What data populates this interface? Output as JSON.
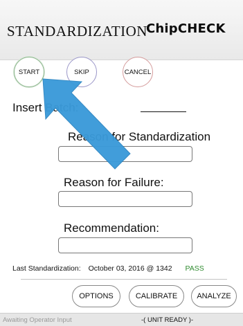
{
  "header": {
    "title": "STANDARDIZATION",
    "brand": "ChipCHECK"
  },
  "controls": {
    "start": "START",
    "skip": "SKIP",
    "cancel": "CANCEL"
  },
  "form": {
    "batch_label": "Insert Batch:",
    "reason_label": "Reason for Standardization",
    "failure_label": "Reason for Failure:",
    "recommendation_label": "Recommendation:",
    "reason_value": "",
    "failure_value": "",
    "recommendation_value": ""
  },
  "last_standardization": {
    "label": "Last Standardization:",
    "date": "October 03, 2016 @ 1342",
    "result": "PASS"
  },
  "actions": {
    "options": "OPTIONS",
    "calibrate": "CALIBRATE",
    "analyze": "ANALYZE"
  },
  "status": {
    "left": "Awaiting Operator Input",
    "center": "-( UNIT READY )-"
  },
  "colors": {
    "arrow": "#3a9ad9",
    "pass": "#2f8b2f"
  }
}
